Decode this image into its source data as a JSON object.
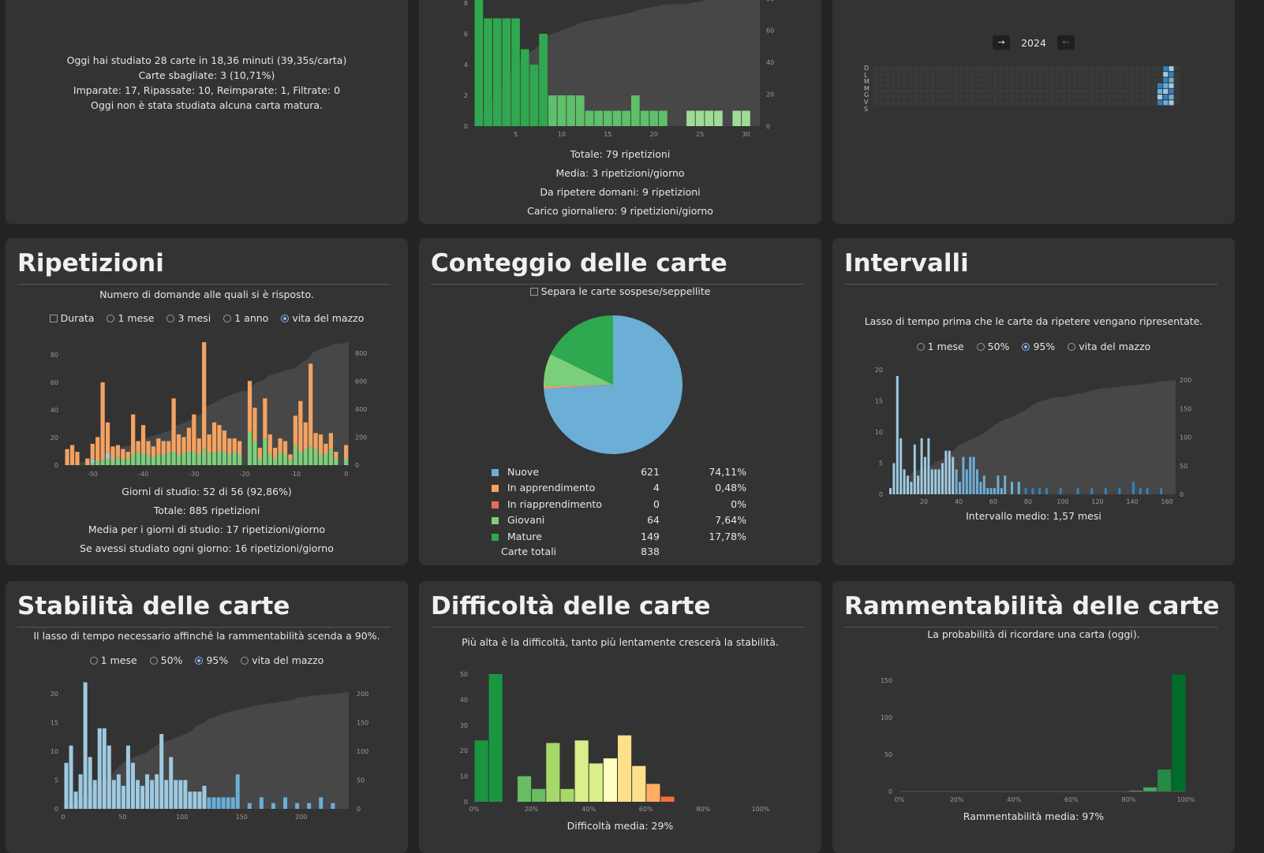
{
  "colors": {
    "bg": "#232323",
    "card": "#333333",
    "green": "#2fa84f",
    "lightgreen": "#7ccf7a",
    "orange": "#f4a261",
    "blue": "#6baed6",
    "lightblue": "#9ecae1",
    "red": "#e76f51"
  },
  "today": {
    "lines": [
      "Oggi hai studiato 28 carte in 18,36 minuti (39,35s/carta)",
      "Carte sbagliate: 3 (10,71%)",
      "Imparate: 17, Ripassate: 10, Reimparate: 1, Filtrate: 0",
      "Oggi non è stata studiata alcuna carta matura."
    ]
  },
  "future": {
    "stats": [
      {
        "label": "Totale:",
        "value": "79 ripetizioni"
      },
      {
        "label": "Media:",
        "value": "3 ripetizioni/giorno"
      },
      {
        "label": "Da ripetere domani:",
        "value": "9 ripetizioni"
      },
      {
        "label": "Carico giornaliero:",
        "value": "9 ripetizioni/giorno"
      }
    ],
    "chart_data": {
      "type": "bar",
      "x": [
        1,
        2,
        3,
        4,
        5,
        6,
        7,
        8,
        9,
        10,
        11,
        12,
        13,
        14,
        15,
        16,
        17,
        18,
        19,
        20,
        21,
        22,
        23,
        24,
        25,
        26,
        27,
        28,
        29,
        30,
        31
      ],
      "values": [
        9,
        7,
        7,
        7,
        7,
        5,
        4,
        6,
        2,
        2,
        2,
        2,
        1,
        1,
        1,
        1,
        1,
        2,
        1,
        1,
        1,
        0,
        0,
        1,
        1,
        1,
        1,
        0,
        1,
        1,
        0
      ],
      "xticks": [
        "5",
        "10",
        "15",
        "20",
        "25",
        "30"
      ],
      "yticks_left": [
        "0",
        "2",
        "4",
        "6",
        "8"
      ],
      "yticks_right": [
        "0",
        "20",
        "40",
        "60",
        "80"
      ]
    }
  },
  "calendar": {
    "year": "2024",
    "prev": "←",
    "next": "→",
    "days": [
      "D",
      "L",
      "M",
      "M",
      "G",
      "V",
      "S"
    ]
  },
  "reviews": {
    "title": "Ripetizioni",
    "subtitle": "Numero di domande alle quali si è risposto.",
    "options": [
      {
        "type": "check",
        "label": "Durata",
        "on": false
      },
      {
        "type": "radio",
        "label": "1 mese",
        "on": false
      },
      {
        "type": "radio",
        "label": "3 mesi",
        "on": false
      },
      {
        "type": "radio",
        "label": "1 anno",
        "on": false
      },
      {
        "type": "radio",
        "label": "vita del mazzo",
        "on": true
      }
    ],
    "stats": [
      {
        "label": "Giorni di studio:",
        "value": "52 di 56 (92,86%)"
      },
      {
        "label": "Totale:",
        "value": "885 ripetizioni"
      },
      {
        "label": "Media per i giorni di studio:",
        "value": "17 ripetizioni/giorno"
      },
      {
        "label": "Se avessi studiato ogni giorno:",
        "value": "16 ripetizioni/giorno"
      }
    ],
    "chart_data": {
      "type": "bar",
      "x": [
        -55,
        -54,
        -53,
        -52,
        -51,
        -50,
        -49,
        -48,
        -47,
        -46,
        -45,
        -44,
        -43,
        -42,
        -41,
        -40,
        -39,
        -38,
        -37,
        -36,
        -35,
        -34,
        -33,
        -32,
        -31,
        -30,
        -29,
        -28,
        -27,
        -26,
        -25,
        -24,
        -23,
        -22,
        -21,
        -20,
        -19,
        -18,
        -17,
        -16,
        -15,
        -14,
        -13,
        -12,
        -11,
        -10,
        -9,
        -8,
        -7,
        -6,
        -5,
        -4,
        -3,
        -2,
        -1,
        0
      ],
      "series": [
        {
          "values": [
            12,
            15,
            10,
            0,
            5,
            12,
            18,
            58,
            23,
            10,
            9,
            8,
            5,
            30,
            8,
            22,
            10,
            8,
            12,
            10,
            9,
            40,
            15,
            12,
            18,
            28,
            12,
            80,
            14,
            22,
            20,
            16,
            12,
            10,
            10,
            0,
            38,
            25,
            8,
            30,
            15,
            8,
            10,
            10,
            4,
            22,
            38,
            20,
            62,
            12,
            15,
            8,
            12,
            5,
            0,
            10
          ]
        },
        {
          "values": [
            0,
            0,
            0,
            0,
            0,
            2,
            0,
            0,
            4,
            1,
            0,
            0,
            0,
            0,
            0,
            0,
            0,
            0,
            0,
            0,
            0,
            0,
            0,
            0,
            0,
            0,
            0,
            0,
            0,
            0,
            0,
            0,
            0,
            0,
            0,
            0,
            0,
            0,
            0,
            0,
            0,
            0,
            0,
            0,
            0,
            0,
            0,
            0,
            0,
            0,
            0,
            0,
            0,
            0,
            0,
            0
          ]
        },
        {
          "values": [
            0,
            0,
            0,
            0,
            0,
            2,
            3,
            4,
            5,
            3,
            6,
            4,
            5,
            8,
            10,
            8,
            8,
            6,
            8,
            8,
            9,
            10,
            8,
            9,
            10,
            10,
            8,
            12,
            9,
            10,
            10,
            10,
            8,
            10,
            8,
            0,
            25,
            18,
            5,
            20,
            8,
            5,
            10,
            8,
            4,
            15,
            10,
            12,
            14,
            12,
            8,
            8,
            12,
            5,
            0,
            5
          ]
        }
      ],
      "xticks": [
        "-50",
        "-40",
        "-30",
        "-20",
        "-10",
        "0"
      ],
      "yticks_left": [
        "0",
        "20",
        "40",
        "60",
        "80"
      ],
      "yticks_right": [
        "0",
        "200",
        "400",
        "600",
        "800"
      ]
    }
  },
  "counts": {
    "title": "Conteggio delle carte",
    "toggle": "Separa le carte sospese/seppellite",
    "rows": [
      {
        "label": "Nuove",
        "count": "621",
        "pct": "74,11%",
        "color": "#6baed6"
      },
      {
        "label": "In apprendimento",
        "count": "4",
        "pct": "0,48%",
        "color": "#f4a261"
      },
      {
        "label": "In riapprendimento",
        "count": "0",
        "pct": "0%",
        "color": "#e76f51"
      },
      {
        "label": "Giovani",
        "count": "64",
        "pct": "7,64%",
        "color": "#7ccf7a"
      },
      {
        "label": "Mature",
        "count": "149",
        "pct": "17,78%",
        "color": "#2fa84f"
      }
    ],
    "total_label": "Carte totali",
    "total": "838",
    "chart_data": {
      "type": "pie",
      "labels": [
        "Nuove",
        "In apprendimento",
        "In riapprendimento",
        "Giovani",
        "Mature"
      ],
      "values": [
        621,
        4,
        0,
        64,
        149
      ]
    }
  },
  "intervals": {
    "title": "Intervalli",
    "subtitle": "Lasso di tempo prima che le carte da ripetere vengano ripresentate.",
    "options": [
      {
        "label": "1 mese",
        "on": false
      },
      {
        "label": "50%",
        "on": false
      },
      {
        "label": "95%",
        "on": true
      },
      {
        "label": "vita del mazzo",
        "on": false
      }
    ],
    "stat": {
      "label": "Intervallo medio:",
      "value": "1,57 mesi"
    },
    "chart_data": {
      "type": "bar",
      "x": [
        2,
        4,
        6,
        8,
        10,
        12,
        14,
        16,
        18,
        20,
        22,
        24,
        26,
        28,
        30,
        32,
        34,
        36,
        38,
        40,
        42,
        44,
        46,
        48,
        50,
        52,
        54,
        56,
        58,
        60,
        62,
        64,
        66,
        68,
        72,
        76,
        80,
        84,
        88,
        92,
        100,
        110,
        118,
        126,
        134,
        142,
        146,
        150,
        158
      ],
      "values": [
        1,
        5,
        19,
        9,
        4,
        3,
        2,
        8,
        3,
        9,
        6,
        9,
        4,
        4,
        4,
        5,
        7,
        7,
        6,
        4,
        2,
        6,
        4,
        6,
        6,
        4,
        2,
        3,
        1,
        1,
        1,
        3,
        1,
        3,
        2,
        2,
        1,
        1,
        1,
        1,
        1,
        1,
        1,
        1,
        1,
        2,
        1,
        1,
        1
      ],
      "xticks": [
        "20",
        "40",
        "60",
        "80",
        "100",
        "120",
        "140",
        "160"
      ],
      "yticks_left": [
        "0",
        "5",
        "10",
        "15",
        "20"
      ],
      "yticks_right": [
        "0",
        "50",
        "100",
        "150",
        "200"
      ]
    }
  },
  "stability": {
    "title": "Stabilità delle carte",
    "subtitle": "Il lasso di tempo necessario affinché la rammentabilità scenda a 90%.",
    "options": [
      {
        "label": "1 mese",
        "on": false
      },
      {
        "label": "50%",
        "on": false
      },
      {
        "label": "95%",
        "on": true
      },
      {
        "label": "vita del mazzo",
        "on": false
      }
    ],
    "chart_data": {
      "type": "bar",
      "x": [
        1,
        5,
        9,
        13,
        17,
        21,
        25,
        29,
        33,
        37,
        41,
        45,
        49,
        53,
        57,
        61,
        65,
        69,
        73,
        77,
        81,
        85,
        89,
        93,
        97,
        101,
        105,
        109,
        113,
        117,
        121,
        125,
        129,
        133,
        137,
        141,
        145,
        155,
        165,
        175,
        185,
        195,
        205,
        215,
        225
      ],
      "values": [
        8,
        11,
        3,
        6,
        22,
        9,
        5,
        14,
        14,
        11,
        5,
        6,
        4,
        11,
        8,
        5,
        4,
        6,
        5,
        6,
        13,
        5,
        9,
        5,
        5,
        5,
        3,
        3,
        3,
        4,
        2,
        2,
        2,
        2,
        2,
        2,
        6,
        1,
        2,
        1,
        2,
        1,
        1,
        2,
        1
      ],
      "xticks": [
        "0",
        "50",
        "100",
        "150",
        "200"
      ],
      "yticks_left": [
        "0",
        "5",
        "10",
        "15",
        "20"
      ],
      "yticks_right": [
        "0",
        "50",
        "100",
        "150",
        "200"
      ]
    }
  },
  "difficulty": {
    "title": "Difficoltà delle carte",
    "subtitle": "Più alta è la difficoltà, tanto più lentamente crescerà la stabilità.",
    "stat": {
      "label": "Difficoltà media:",
      "value": "29%"
    },
    "chart_data": {
      "type": "bar",
      "x": [
        "0%",
        "5%",
        "10%",
        "15%",
        "20%",
        "25%",
        "30%",
        "35%",
        "40%",
        "45%",
        "50%",
        "55%",
        "60%",
        "65%",
        "70%"
      ],
      "values": [
        24,
        50,
        0,
        10,
        5,
        23,
        5,
        24,
        15,
        17,
        26,
        14,
        7,
        2,
        0
      ],
      "xticks": [
        "0%",
        "20%",
        "40%",
        "60%",
        "80%",
        "100%"
      ],
      "yticks_left": [
        "0",
        "10",
        "20",
        "30",
        "40",
        "50"
      ]
    }
  },
  "retrievability": {
    "title": "Rammentabilità delle carte",
    "subtitle": "La probabilità di ricordare una carta (oggi).",
    "stat": {
      "label": "Rammentabilità media:",
      "value": "97%"
    },
    "chart_data": {
      "type": "bar",
      "x": [
        "80%",
        "85%",
        "90%",
        "95%",
        "100%"
      ],
      "values": [
        1,
        6,
        32,
        170
      ],
      "xticks": [
        "0%",
        "20%",
        "40%",
        "60%",
        "80%",
        "100%"
      ],
      "yticks_left": [
        "0",
        "50",
        "100",
        "150"
      ]
    }
  }
}
